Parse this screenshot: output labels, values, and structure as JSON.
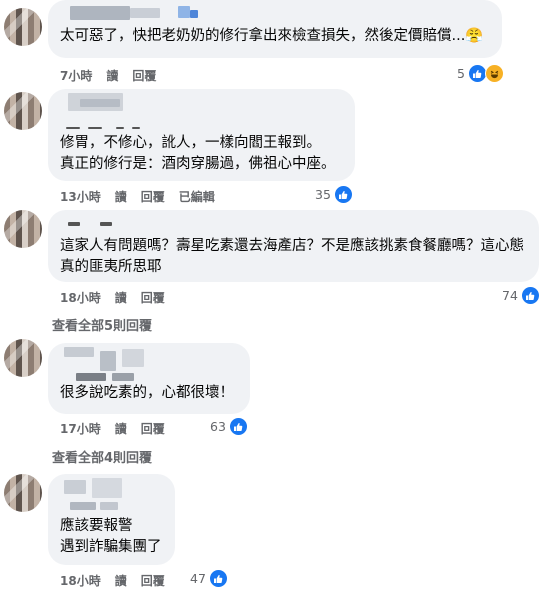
{
  "comments": [
    {
      "text": "太可惡了，快把老奶奶的修行拿出來檢查損失，然後定價賠償...😤",
      "time": "7小時",
      "read_label": "讀",
      "reply_label": "回覆",
      "edited_label": "",
      "reaction_count": "5"
    },
    {
      "text": "修胃，不修心，訛人，一樣向閻王報到。\n真正的修行是：酒肉穿腸過，佛祖心中座。",
      "time": "13小時",
      "read_label": "讀",
      "reply_label": "回覆",
      "edited_label": "已編輯",
      "reaction_count": "35"
    },
    {
      "text": "這家人有問題嗎？壽星吃素還去海產店？不是應該挑素食餐廳嗎？這心態真的匪夷所思耶",
      "time": "18小時",
      "read_label": "讀",
      "reply_label": "回覆",
      "edited_label": "",
      "reaction_count": "74",
      "view_more": "查看全部5則回覆"
    },
    {
      "text": "很多說吃素的，心都很壞！",
      "time": "17小時",
      "read_label": "讀",
      "reply_label": "回覆",
      "edited_label": "",
      "reaction_count": "63",
      "view_more": "查看全部4則回覆"
    },
    {
      "text": "應該要報警\n遇到詐騙集團了",
      "time": "18小時",
      "read_label": "讀",
      "reply_label": "回覆",
      "edited_label": "",
      "reaction_count": "47"
    }
  ],
  "colors": {
    "bubble_bg": "#f0f2f5",
    "meta_text": "#65676b",
    "like_blue": "#1877f2",
    "haha_yellow": "#f7b125"
  },
  "icons": {
    "like": "like-icon",
    "haha": "haha-icon"
  }
}
